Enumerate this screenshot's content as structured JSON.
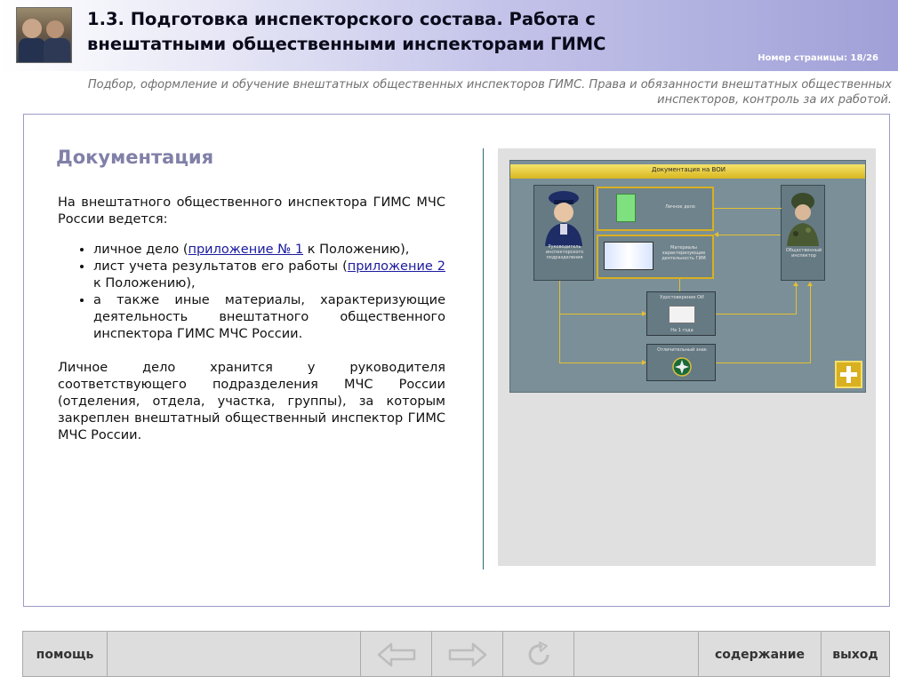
{
  "header": {
    "title": "1.3. Подготовка инспекторского состава. Работа с внештатными общественными инспекторами ГИМС",
    "page_number": "Номер страницы: 18/26"
  },
  "subtitle": "Подбор, оформление и обучение внештатных общественных инспекторов ГИМС. Права и обязанности внештатных общественных инспекторов, контроль за их работой.",
  "content": {
    "title": "Документация",
    "intro": "На внештатного общественного инспектора ГИМС МЧС России ведется:",
    "item1_before": "личное дело (",
    "item1_link": "приложение № 1",
    "item1_after": " к Положению),",
    "item2_before": "лист учета результатов его работы (",
    "item2_link": "приложение 2",
    "item2_after": " к Положению),",
    "item3": "а также иные материалы, характеризующие деятельность внештатного общественного инспектора ГИМС МЧС России.",
    "paragraph2": "Личное дело хранится у руководителя соответствующего подразделения МЧС России (отделения, отдела, участка, группы), за которым закреплен внештатный общественный инспектор ГИМС МЧС России."
  },
  "diagram": {
    "title": "Документация на ВОИ",
    "left_caption": "Руководитель инспекторского подразделения",
    "right_caption": "Общественный инспектор",
    "box_personal": "Личное дело",
    "box_materials": "Материалы характеризующие деятельность ГИМ",
    "box_certificate": "Удостоверение ОИ",
    "box_certificate_sub": "На 1 года",
    "box_badge": "Отличительный знак"
  },
  "nav": {
    "help": "помощь",
    "contents": "содержание",
    "exit": "выход"
  },
  "colors": {
    "header_gradient_end": "#a0a0d8",
    "content_title": "#8080a8",
    "link": "#1b1b9e",
    "diagram_accent": "#e3c031"
  }
}
